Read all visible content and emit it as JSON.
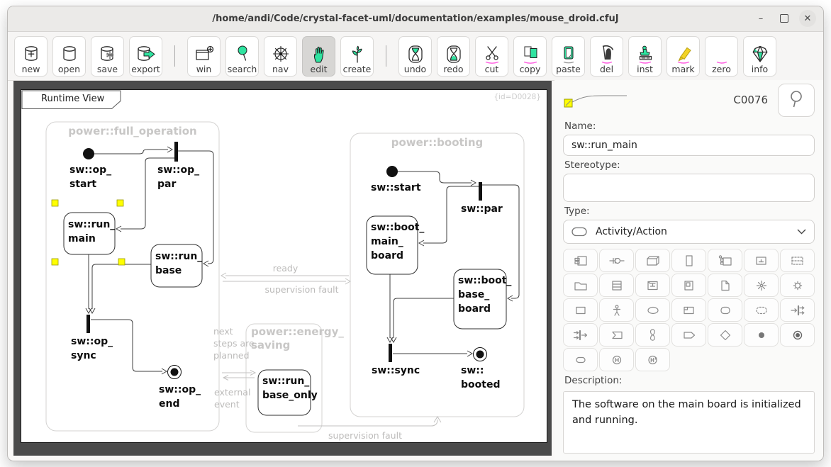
{
  "window": {
    "title": "/home/andi/Code/crystal-facet-uml/documentation/examples/mouse_droid.cfuJ",
    "minimize_glyph": "–",
    "close_glyph": "✕"
  },
  "toolbar": {
    "items": [
      {
        "name": "new",
        "label": "new"
      },
      {
        "name": "open",
        "label": "open"
      },
      {
        "name": "save",
        "label": "save"
      },
      {
        "name": "export",
        "label": "export"
      },
      {
        "name": "win",
        "label": "win"
      },
      {
        "name": "search",
        "label": "search"
      },
      {
        "name": "nav",
        "label": "nav"
      },
      {
        "name": "edit",
        "label": "edit"
      },
      {
        "name": "create",
        "label": "create"
      },
      {
        "name": "undo",
        "label": "undo"
      },
      {
        "name": "redo",
        "label": "redo"
      },
      {
        "name": "cut",
        "label": "cut"
      },
      {
        "name": "copy",
        "label": "copy"
      },
      {
        "name": "paste",
        "label": "paste"
      },
      {
        "name": "del",
        "label": "del"
      },
      {
        "name": "inst",
        "label": "inst"
      },
      {
        "name": "mark",
        "label": "mark"
      },
      {
        "name": "zero",
        "label": "zero"
      },
      {
        "name": "info",
        "label": "info"
      }
    ],
    "active_item": "edit"
  },
  "diagram": {
    "tab_label": "Runtime View",
    "id_note": "{id=D0028}",
    "labels": {
      "full_operation": "power::full_operation",
      "booting": "power::booting",
      "energy_saving": "power::energy_\nsaving",
      "op_start": "sw::op_\nstart",
      "op_par": "sw::op_\npar",
      "run_main": "sw::run_\nmain",
      "run_base": "sw::run_\nbase",
      "op_sync": "sw::op_\nsync",
      "op_end": "sw::op_\nend",
      "sw_start": "sw::start",
      "sw_par": "sw::par",
      "boot_main_board": "sw::boot_\nmain_\nboard",
      "boot_base_board": "sw::boot_\nbase_\nboard",
      "sw_sync": "sw::sync",
      "sw_booted": "sw::\nbooted",
      "run_base_only": "sw::run_\nbase_only",
      "ready": "ready",
      "supervision_fault_top": "supervision fault",
      "next_steps": "next\nsteps are\nplanned",
      "external_event": "external\nevent",
      "supervision_fault_bottom": "supervision fault"
    },
    "selection_color": "#ffff00"
  },
  "panel": {
    "element_id": "C0076",
    "name_label": "Name:",
    "name_value": "sw::run_main",
    "stereotype_label": "Stereotype:",
    "stereotype_value": "",
    "type_label": "Type:",
    "type_value": "Activity/Action",
    "description_label": "Description:",
    "description_value": "The software on the main board is initialized and running.",
    "type_grid_icons": [
      "component",
      "interface",
      "node",
      "class",
      "part",
      "artifact",
      "dashed-list",
      "folder",
      "table",
      "frame",
      "page-overlay",
      "page",
      "burst",
      "gear",
      "rectangle",
      "actor",
      "ellipse",
      "region",
      "rounded-rect",
      "dashed-rounded-rect",
      "fork",
      "join",
      "accept-event",
      "timeout",
      "send-signal",
      "decision",
      "initial-node",
      "final-node",
      "activity",
      "shallow-history",
      "deep-history"
    ]
  },
  "theme": {
    "accent_green": "#2fe3a0",
    "selection_yellow": "#ffff00",
    "underline_pink": "#ff5ce1",
    "canvas_dark": "#4b4b4b"
  }
}
